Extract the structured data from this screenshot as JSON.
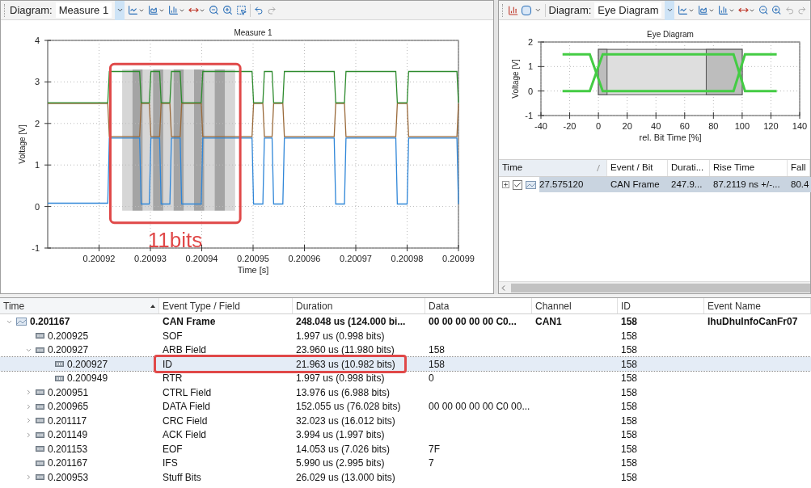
{
  "left_pane": {
    "toolbar": {
      "label": "Diagram:",
      "value": "Measure 1"
    },
    "chart": {
      "chart_data": {
        "type": "line",
        "title": "Measure 1",
        "xlabel": "Time [s]",
        "ylabel": "Voltage [V]",
        "grid": true,
        "xlim": [
          0.20091,
          0.20099
        ],
        "ylim": [
          -1,
          4
        ],
        "xticks": [
          0.20092,
          0.20093,
          0.20094,
          0.20095,
          0.20096,
          0.20097,
          0.20098,
          0.20099
        ],
        "yticks": [
          -1,
          0,
          1,
          2,
          3,
          4
        ],
        "x": [
          0.20091,
          0.2009217,
          0.200922,
          0.2009279,
          0.2009282,
          0.2009298,
          0.2009301,
          0.2009318,
          0.2009321,
          0.2009338,
          0.2009341,
          0.2009358,
          0.2009361,
          0.2009399,
          0.2009402,
          0.2009498,
          0.2009501,
          0.2009519,
          0.2009522,
          0.2009537,
          0.200954,
          0.2009558,
          0.2009561,
          0.2009658,
          0.2009661,
          0.2009678,
          0.2009681,
          0.2009778,
          0.2009781,
          0.20098,
          0.2009803,
          0.2009897,
          0.20099
        ],
        "series": [
          {
            "color": "#9a6a3a",
            "values": [
              2.48,
              2.48,
              1.68,
              1.68,
              2.48,
              2.48,
              1.68,
              1.68,
              2.48,
              2.48,
              1.68,
              1.68,
              2.48,
              2.48,
              1.68,
              1.68,
              2.48,
              2.48,
              1.68,
              1.68,
              2.48,
              2.48,
              1.68,
              1.68,
              2.48,
              2.48,
              1.68,
              1.68,
              2.48,
              2.48,
              1.68,
              1.68,
              2.48
            ]
          },
          {
            "color": "#2e8b2e",
            "values": [
              2.5,
              2.5,
              3.25,
              3.25,
              2.5,
              2.5,
              3.25,
              3.25,
              2.5,
              2.5,
              3.25,
              3.25,
              2.5,
              2.5,
              3.25,
              3.25,
              2.5,
              2.5,
              3.25,
              3.25,
              2.5,
              2.5,
              3.25,
              3.25,
              2.5,
              2.5,
              3.25,
              3.25,
              2.5,
              2.5,
              3.25,
              3.25,
              2.5
            ]
          },
          {
            "color": "#2f86d8",
            "values": [
              0.08,
              0.08,
              1.65,
              1.65,
              0.06,
              0.06,
              1.65,
              1.65,
              0.06,
              0.06,
              1.65,
              1.65,
              0.06,
              0.06,
              1.65,
              1.65,
              0.06,
              0.06,
              1.65,
              1.65,
              0.06,
              0.06,
              1.65,
              1.65,
              0.06,
              0.06,
              1.65,
              1.65,
              0.06,
              0.06,
              1.65,
              1.65,
              0.06
            ]
          }
        ],
        "annotations": [
          "11bits"
        ]
      }
    }
  },
  "right_pane": {
    "toolbar": {
      "label": "Diagram:",
      "value": "Eye Diagram"
    },
    "chart": {
      "chart_data": {
        "type": "line",
        "title": "Eye Diagram",
        "xlabel": "rel. Bit Time [%]",
        "ylabel": "Voltage [V]",
        "grid": true,
        "xlim": [
          -40,
          140
        ],
        "ylim": [
          -1,
          2
        ],
        "xticks": [
          -40,
          -20,
          0,
          20,
          40,
          60,
          80,
          100,
          120,
          140
        ],
        "yticks": [
          -1,
          0,
          1,
          2
        ],
        "x": [
          -25,
          -6,
          3,
          94,
          102,
          124
        ],
        "series": [
          {
            "color": "#44cc44",
            "values": [
              1.5,
              1.5,
              0,
              0,
              1.5,
              1.5
            ]
          },
          {
            "color": "#44cc44",
            "values": [
              0,
              0,
              1.5,
              1.5,
              0,
              0
            ]
          }
        ]
      }
    },
    "table": {
      "columns": [
        {
          "label": "Time",
          "sorted": true
        },
        {
          "label": "Event / Bit",
          "sorted": false
        },
        {
          "label": "Durati...",
          "sorted": false
        },
        {
          "label": "Rise Time",
          "sorted": false
        },
        {
          "label": "Fall",
          "sorted": false
        }
      ],
      "rows": [
        {
          "selected": true,
          "expanded": false,
          "checked": true,
          "cells": [
            "27.575120",
            "CAN Frame",
            "247.9...",
            "87.2119 ns +/-...",
            "80.4"
          ]
        }
      ]
    }
  },
  "events_table": {
    "columns": [
      {
        "label": "Time",
        "sorted": true
      },
      {
        "label": "Event Type / Field",
        "sorted": false
      },
      {
        "label": "Duration",
        "sorted": false
      },
      {
        "label": "Data",
        "sorted": false
      },
      {
        "label": "Channel",
        "sorted": false
      },
      {
        "label": "ID",
        "sorted": false
      },
      {
        "label": "Event Name",
        "sorted": false
      }
    ],
    "rows": [
      {
        "kind": "frame",
        "expanded": true,
        "selected": false,
        "callout": false,
        "cells": [
          "0.201167",
          "CAN Frame",
          "248.048 us (124.000 bi...",
          "00 00 00 00 00 C0...",
          "CAN1",
          "158",
          "IhuDhuInfoCanFr07"
        ],
        "children": [
          {
            "kind": "field",
            "selected": false,
            "callout": false,
            "cells": [
              "0.200925",
              "SOF",
              "1.997 us (0.998 bits)",
              null,
              null,
              "158"
            ]
          },
          {
            "kind": "field",
            "expanded": true,
            "selected": false,
            "callout": false,
            "cells": [
              "0.200927",
              "ARB Field",
              "23.960 us (11.980 bits)",
              "158",
              null,
              "158"
            ],
            "children": [
              {
                "kind": "field",
                "selected": true,
                "callout": true,
                "cells": [
                  "0.200927",
                  "ID",
                  "21.963 us (10.982 bits)",
                  "158",
                  null,
                  "158"
                ]
              },
              {
                "kind": "field",
                "selected": false,
                "callout": false,
                "cells": [
                  "0.200949",
                  "RTR",
                  "1.997 us (0.998 bits)",
                  "0",
                  null,
                  "158"
                ]
              }
            ]
          },
          {
            "kind": "field",
            "expanded": false,
            "selected": false,
            "callout": false,
            "cells": [
              "0.200951",
              "CTRL Field",
              "13.976 us (6.988 bits)",
              null,
              null,
              "158"
            ]
          },
          {
            "kind": "field",
            "expanded": false,
            "selected": false,
            "callout": false,
            "cells": [
              "0.200965",
              "DATA Field",
              "152.055 us (76.028 bits)",
              "00 00 00 00 00 C0 00...",
              null,
              "158"
            ]
          },
          {
            "kind": "field",
            "expanded": false,
            "selected": false,
            "callout": false,
            "cells": [
              "0.201117",
              "CRC Field",
              "32.023 us (16.012 bits)",
              null,
              null,
              "158"
            ]
          },
          {
            "kind": "field",
            "expanded": false,
            "selected": false,
            "callout": false,
            "cells": [
              "0.201149",
              "ACK Field",
              "3.994 us (1.997 bits)",
              null,
              null,
              "158"
            ]
          },
          {
            "kind": "field",
            "selected": false,
            "callout": false,
            "cells": [
              "0.201153",
              "EOF",
              "14.053 us (7.026 bits)",
              "7F",
              null,
              "158"
            ]
          },
          {
            "kind": "field",
            "selected": false,
            "callout": false,
            "cells": [
              "0.201167",
              "IFS",
              "5.990 us (2.995 bits)",
              "7",
              null,
              "158"
            ]
          },
          {
            "kind": "field",
            "expanded": false,
            "selected": false,
            "callout": false,
            "cells": [
              "0.200953",
              "Stuff Bits",
              "26.029 us (13.000 bits)",
              null,
              null,
              "158"
            ]
          }
        ]
      }
    ]
  }
}
